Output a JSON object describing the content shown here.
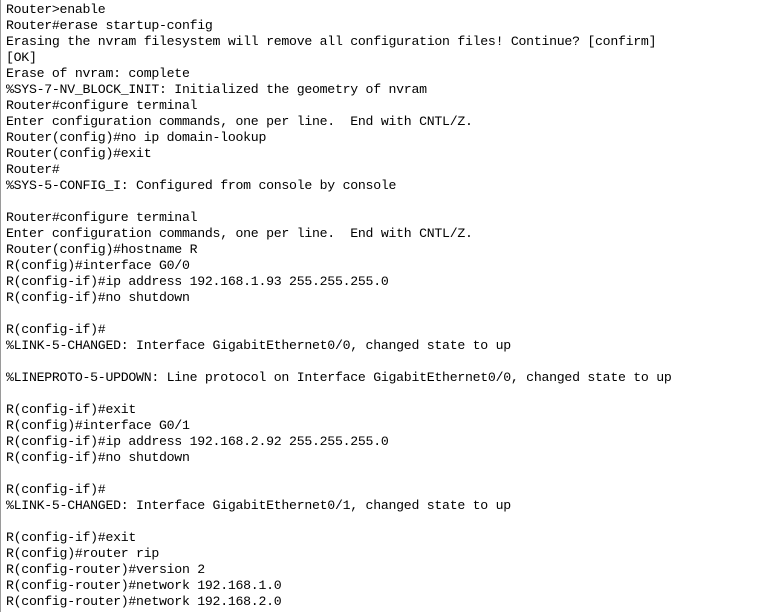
{
  "window": {
    "title": "Router CLI Console Output",
    "app": "cisco-ios-cli-terminal",
    "background_color": "#ffffff",
    "text_color": "#000000",
    "border_color": "#9a9a9a"
  },
  "console": {
    "name": "cli-console-output",
    "device_hostname_initial": "Router",
    "device_hostname_final": "R",
    "lines": [
      "Router>enable",
      "Router#erase startup-config",
      "Erasing the nvram filesystem will remove all configuration files! Continue? [confirm]",
      "[OK]",
      "Erase of nvram: complete",
      "%SYS-7-NV_BLOCK_INIT: Initialized the geometry of nvram",
      "Router#configure terminal",
      "Enter configuration commands, one per line.  End with CNTL/Z.",
      "Router(config)#no ip domain-lookup",
      "Router(config)#exit",
      "Router#",
      "%SYS-5-CONFIG_I: Configured from console by console",
      "",
      "Router#configure terminal",
      "Enter configuration commands, one per line.  End with CNTL/Z.",
      "Router(config)#hostname R",
      "R(config)#interface G0/0",
      "R(config-if)#ip address 192.168.1.93 255.255.255.0",
      "R(config-if)#no shutdown",
      "",
      "R(config-if)#",
      "%LINK-5-CHANGED: Interface GigabitEthernet0/0, changed state to up",
      "",
      "%LINEPROTO-5-UPDOWN: Line protocol on Interface GigabitEthernet0/0, changed state to up",
      "",
      "R(config-if)#exit",
      "R(config)#interface G0/1",
      "R(config-if)#ip address 192.168.2.92 255.255.255.0",
      "R(config-if)#no shutdown",
      "",
      "R(config-if)#",
      "%LINK-5-CHANGED: Interface GigabitEthernet0/1, changed state to up",
      "",
      "R(config-if)#exit",
      "R(config)#router rip",
      "R(config-router)#version 2",
      "R(config-router)#network 192.168.1.0",
      "R(config-router)#network 192.168.2.0"
    ],
    "commands_entered": [
      "enable",
      "erase startup-config",
      "configure terminal",
      "no ip domain-lookup",
      "exit",
      "configure terminal",
      "hostname R",
      "interface G0/0",
      "ip address 192.168.1.93 255.255.255.0",
      "no shutdown",
      "exit",
      "interface G0/1",
      "ip address 192.168.2.92 255.255.255.0",
      "no shutdown",
      "exit",
      "router rip",
      "version 2",
      "network 192.168.1.0",
      "network 192.168.2.0"
    ],
    "interfaces": [
      {
        "short_name": "G0/0",
        "full_name": "GigabitEthernet0/0",
        "ip_address": "192.168.1.93",
        "subnet_mask": "255.255.255.0",
        "state": "up"
      },
      {
        "short_name": "G0/1",
        "full_name": "GigabitEthernet0/1",
        "ip_address": "192.168.2.92",
        "subnet_mask": "255.255.255.0",
        "state": "up"
      }
    ],
    "routing": {
      "protocol": "rip",
      "version": "2",
      "networks": [
        "192.168.1.0",
        "192.168.2.0"
      ]
    },
    "system_messages": [
      "%SYS-7-NV_BLOCK_INIT: Initialized the geometry of nvram",
      "%SYS-5-CONFIG_I: Configured from console by console",
      "%LINK-5-CHANGED: Interface GigabitEthernet0/0, changed state to up",
      "%LINEPROTO-5-UPDOWN: Line protocol on Interface GigabitEthernet0/0, changed state to up",
      "%LINK-5-CHANGED: Interface GigabitEthernet0/1, changed state to up"
    ]
  }
}
